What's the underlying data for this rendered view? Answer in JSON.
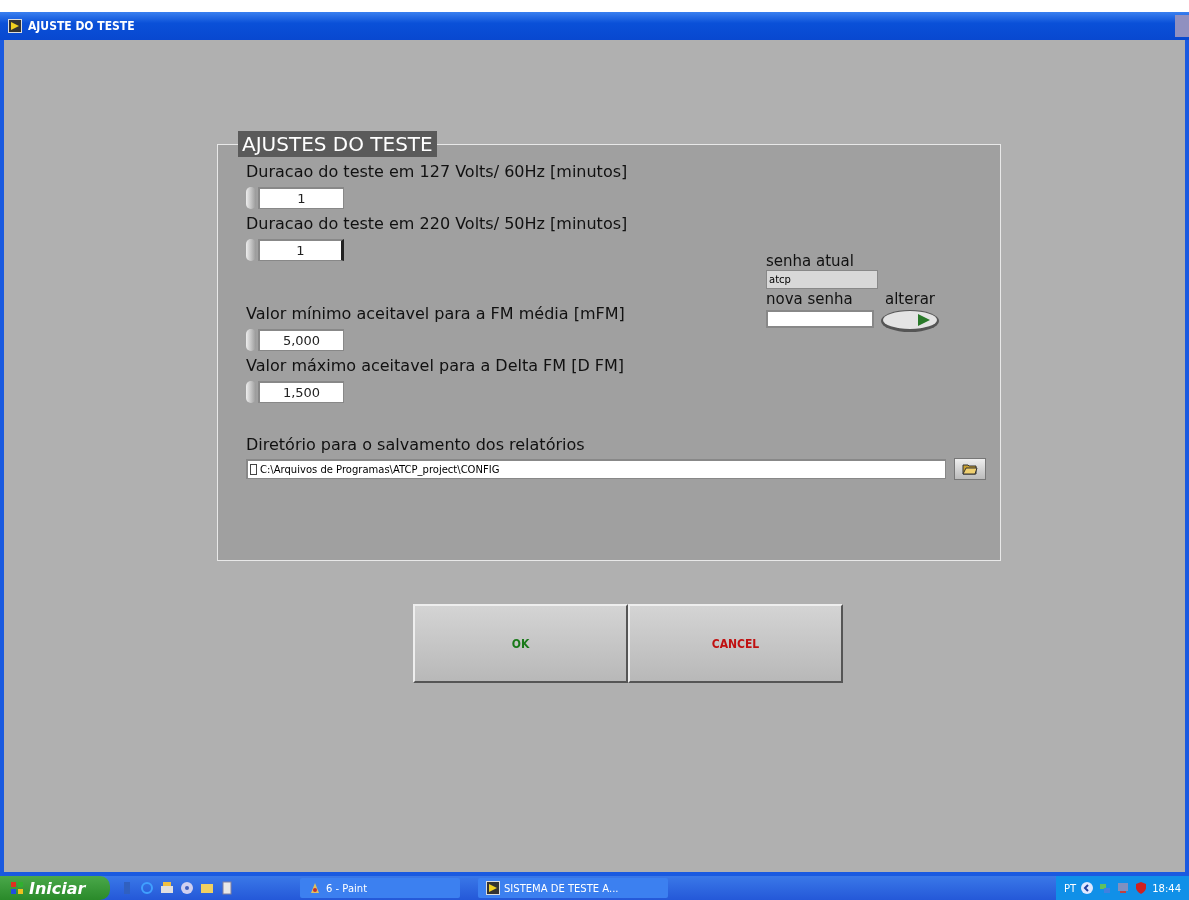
{
  "window": {
    "title": "AJUSTE DO TESTE"
  },
  "panel": {
    "title": "AJUSTES DO TESTE",
    "fields": [
      {
        "label": "Duracao do teste em 127 Volts/ 60Hz [minutos]",
        "value": "1",
        "focused": false
      },
      {
        "label": "Duracao do teste em 220 Volts/ 50Hz [minutos]",
        "value": "1",
        "focused": true
      },
      {
        "label": "Valor mínimo aceitavel para a FM média [mFM]",
        "value": "5,000",
        "focused": false
      },
      {
        "label": "Valor máximo aceitavel para a Delta FM [D FM]",
        "value": "1,500",
        "focused": false
      }
    ],
    "password": {
      "current_label": "senha atual",
      "current_value": "atcp",
      "new_label": "nova senha",
      "change_label": "alterar"
    },
    "path": {
      "label": "Diretório para o salvamento dos relatórios",
      "value": "C:\\Arquivos de Programas\\ATCP_project\\CONFIG"
    }
  },
  "buttons": [
    {
      "label": "OK",
      "color": "#1a7a1a"
    },
    {
      "label": "CANCEL",
      "color": "#c01010"
    }
  ],
  "taskbar": {
    "start": "Iniciar",
    "tasks": [
      {
        "label": "6 - Paint",
        "kind": "paint"
      },
      {
        "label": "SISTEMA DE TESTE A...",
        "kind": "app"
      }
    ],
    "language": "PT",
    "clock": "18:44"
  }
}
